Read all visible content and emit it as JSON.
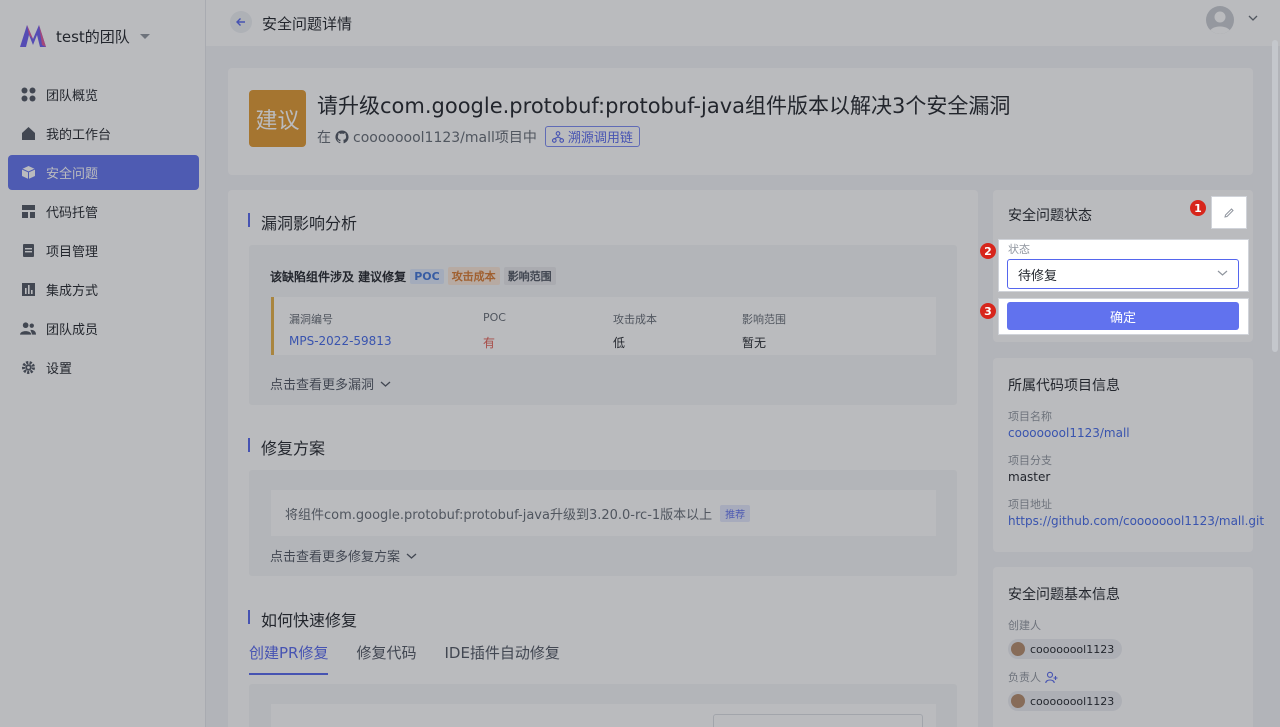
{
  "sidebar": {
    "team_name": "test的团队",
    "items": [
      {
        "label": "团队概览",
        "icon": "grid-icon"
      },
      {
        "label": "我的工作台",
        "icon": "home-icon"
      },
      {
        "label": "安全问题",
        "icon": "cube-icon",
        "active": true
      },
      {
        "label": "代码托管",
        "icon": "layout-icon"
      },
      {
        "label": "项目管理",
        "icon": "clipboard-icon"
      },
      {
        "label": "集成方式",
        "icon": "chart-icon"
      },
      {
        "label": "团队成员",
        "icon": "users-icon"
      },
      {
        "label": "设置",
        "icon": "gear-icon"
      }
    ]
  },
  "topbar": {
    "title": "安全问题详情"
  },
  "header": {
    "badge": "建议",
    "title": "请升级com.google.protobuf:protobuf-java组件版本以解决3个安全漏洞",
    "repo_prefix": "在",
    "repo_name": "coooooool1123/mall项目中",
    "trace_label": "溯源调用链"
  },
  "impact": {
    "section_title": "漏洞影响分析",
    "summary": "该缺陷组件涉及 建议修复",
    "tags": {
      "poc": "POC",
      "cost": "攻击成本",
      "scope": "影响范围"
    },
    "columns": [
      "漏洞编号",
      "POC",
      "攻击成本",
      "影响范围"
    ],
    "row": {
      "id": "MPS-2022-59813",
      "poc": "有",
      "cost": "低",
      "scope": "暂无"
    },
    "more": "点击查看更多漏洞"
  },
  "fix": {
    "section_title": "修复方案",
    "plan": "将组件com.google.protobuf:protobuf-java升级到3.20.0-rc-1版本以上",
    "recommend": "推荐",
    "more": "点击查看更多修复方案"
  },
  "quick": {
    "section_title": "如何快速修复",
    "tabs": [
      "创建PR修复",
      "修复代码",
      "IDE插件自动修复"
    ]
  },
  "status_panel": {
    "title": "安全问题状态",
    "field_label": "状态",
    "selected": "待修复",
    "confirm": "确定",
    "markers": [
      "1",
      "2",
      "3"
    ]
  },
  "project_info": {
    "title": "所属代码项目信息",
    "name_label": "项目名称",
    "name_value": "coooooool1123/mall",
    "branch_label": "项目分支",
    "branch_value": "master",
    "url_label": "项目地址",
    "url_value": "https://github.com/coooooool1123/mall.git"
  },
  "basic_info": {
    "title": "安全问题基本信息",
    "creator_label": "创建人",
    "creator": "coooooool1123",
    "owner_label": "负责人",
    "owner": "coooooool1123"
  },
  "colors": {
    "accent": "#6172ee",
    "badge": "#e1982f",
    "marker": "#d7261c"
  }
}
